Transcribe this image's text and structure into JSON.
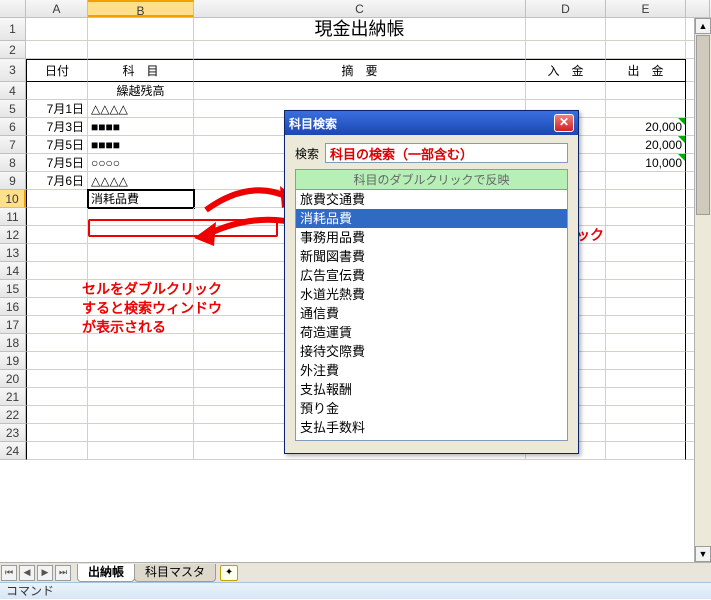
{
  "columns": [
    "A",
    "B",
    "C",
    "D",
    "E"
  ],
  "title": "現金出納帳",
  "headers": {
    "date": "日付",
    "account": "科　目",
    "summary": "摘　要",
    "debit": "入　金",
    "credit": "出　金"
  },
  "carryover": "繰越残高",
  "rows": [
    {
      "date": "7月1日",
      "account": "△△△△",
      "credit": ""
    },
    {
      "date": "7月3日",
      "account": "■■■■",
      "credit": "20,000"
    },
    {
      "date": "7月5日",
      "account": "■■■■",
      "credit": "20,000"
    },
    {
      "date": "7月5日",
      "account": "○○○○",
      "credit": "10,000"
    },
    {
      "date": "7月6日",
      "account": "△△△△",
      "credit": ""
    }
  ],
  "active_cell_value": "消耗品費",
  "dialog": {
    "title": "科目検索",
    "search_label": "検索",
    "search_text": "科目の検索（一部含む）",
    "list_header": "科目のダブルクリックで反映",
    "selected_index": 1,
    "items": [
      "旅費交通費",
      "消耗品費",
      "事務用品費",
      "新聞図書費",
      "広告宣伝費",
      "水道光熱費",
      "通信費",
      "荷造運賃",
      "接待交際費",
      "外注費",
      "支払報酬",
      "預り金",
      "支払手数料"
    ]
  },
  "annotations": {
    "left": "セルをダブルクリック\nすると検索ウィンドウ\nが表示される",
    "right": "対象の科目をダブルクリック\nするとシート反映する"
  },
  "tabs": {
    "active": "出納帳",
    "other": "科目マスタ"
  },
  "status": "コマンド"
}
